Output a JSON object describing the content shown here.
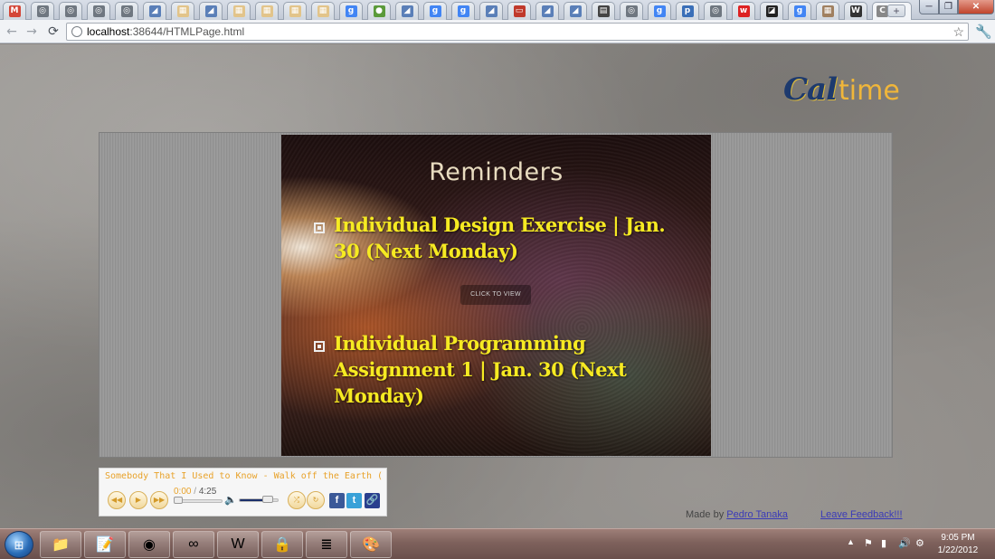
{
  "browser": {
    "tabs": [
      {
        "icon": "gmail-icon",
        "glyph": "M",
        "color": "#d44638"
      },
      {
        "icon": "globe-icon",
        "glyph": "◎",
        "color": "#6f7780"
      },
      {
        "icon": "globe-icon",
        "glyph": "◎",
        "color": "#6f7780"
      },
      {
        "icon": "globe-icon",
        "glyph": "◎",
        "color": "#6f7780"
      },
      {
        "icon": "globe-icon",
        "glyph": "◎",
        "color": "#6f7780"
      },
      {
        "icon": "page-icon",
        "glyph": "◢",
        "color": "#5a7fb8"
      },
      {
        "icon": "page-icon",
        "glyph": "▦",
        "color": "#e2c48a"
      },
      {
        "icon": "page-icon",
        "glyph": "◢",
        "color": "#5a7fb8"
      },
      {
        "icon": "page-icon",
        "glyph": "▦",
        "color": "#e2c48a"
      },
      {
        "icon": "page-icon",
        "glyph": "▦",
        "color": "#e2c48a"
      },
      {
        "icon": "page-icon",
        "glyph": "▦",
        "color": "#e2c48a"
      },
      {
        "icon": "page-icon",
        "glyph": "▦",
        "color": "#e2c48a"
      },
      {
        "icon": "google-icon",
        "glyph": "g",
        "color": "#4285f4"
      },
      {
        "icon": "maps-icon",
        "glyph": "●",
        "color": "#5a9a3a"
      },
      {
        "icon": "page-icon",
        "glyph": "◢",
        "color": "#5a7fb8"
      },
      {
        "icon": "google-icon",
        "glyph": "g",
        "color": "#4285f4"
      },
      {
        "icon": "google-icon",
        "glyph": "g",
        "color": "#4285f4"
      },
      {
        "icon": "page-icon",
        "glyph": "◢",
        "color": "#5a7fb8"
      },
      {
        "icon": "presentation-icon",
        "glyph": "▭",
        "color": "#c0392b"
      },
      {
        "icon": "page-icon",
        "glyph": "◢",
        "color": "#5a7fb8"
      },
      {
        "icon": "page-icon",
        "glyph": "◢",
        "color": "#5a7fb8"
      },
      {
        "icon": "document-icon",
        "glyph": "▤",
        "color": "#444444"
      },
      {
        "icon": "globe-icon",
        "glyph": "◎",
        "color": "#6f7780"
      },
      {
        "icon": "google-icon",
        "glyph": "g",
        "color": "#4285f4"
      },
      {
        "icon": "page-icon",
        "glyph": "p",
        "color": "#3a6fb8"
      },
      {
        "icon": "page-icon",
        "glyph": "◎",
        "color": "#6f7780"
      },
      {
        "icon": "page-icon",
        "glyph": "w",
        "color": "#d22"
      },
      {
        "icon": "page-icon",
        "glyph": "◪",
        "color": "#222"
      },
      {
        "icon": "google-icon",
        "glyph": "g",
        "color": "#4285f4"
      },
      {
        "icon": "page-icon",
        "glyph": "▦",
        "color": "#a08060"
      },
      {
        "icon": "wikipedia-icon",
        "glyph": "W",
        "color": "#333"
      }
    ],
    "active_tab": {
      "glyph": "C",
      "close": "×"
    },
    "new_tab": "+",
    "window": {
      "minimize": "─",
      "maximize": "❐",
      "close": "✕"
    },
    "nav": {
      "back": "←",
      "forward": "→",
      "reload": "⟳"
    },
    "url_host": "localhost",
    "url_rest": ":38644/HTMLPage.html",
    "star": "☆",
    "wrench": "🔧"
  },
  "page": {
    "brand": {
      "cal": "Cal",
      "time": "time"
    },
    "slide": {
      "title": "Reminders",
      "items": [
        "Individual Design Exercise | Jan. 30 (Next Monday)",
        "Individual Programming Assignment 1 | Jan. 30 (Next Monday)"
      ],
      "click_to_view": "CLICK TO VIEW"
    },
    "player": {
      "song": "Somebody That I Used to Know - Walk off the Earth (Go...",
      "current_time": "0:00",
      "separator": "/",
      "total_time": "4:25",
      "rewind": "◀◀",
      "play": "▶",
      "fast_forward": "▶▶",
      "volume_icon": "🔈",
      "volume_level": 0.7,
      "shuffle": "⤮",
      "repeat": "↻",
      "facebook": "f",
      "twitter": "t",
      "link": "🔗"
    },
    "footer": {
      "made_by": "Made by",
      "author": "Pedro Tanaka",
      "feedback": "Leave Feedback!!!"
    }
  },
  "taskbar": {
    "start": "⊞",
    "apps": [
      {
        "name": "explorer",
        "glyph": "📁"
      },
      {
        "name": "notepad",
        "glyph": "📝"
      },
      {
        "name": "chrome",
        "glyph": "◉"
      },
      {
        "name": "visual-studio",
        "glyph": "∞"
      },
      {
        "name": "word",
        "glyph": "W"
      },
      {
        "name": "keepass",
        "glyph": "🔒"
      },
      {
        "name": "database",
        "glyph": "≣"
      },
      {
        "name": "paint",
        "glyph": "🎨"
      }
    ],
    "tray_arrow": "▲",
    "tray": [
      "⚑",
      "▮",
      "🔊",
      "⚙"
    ],
    "time": "9:05 PM",
    "date": "1/22/2012"
  }
}
